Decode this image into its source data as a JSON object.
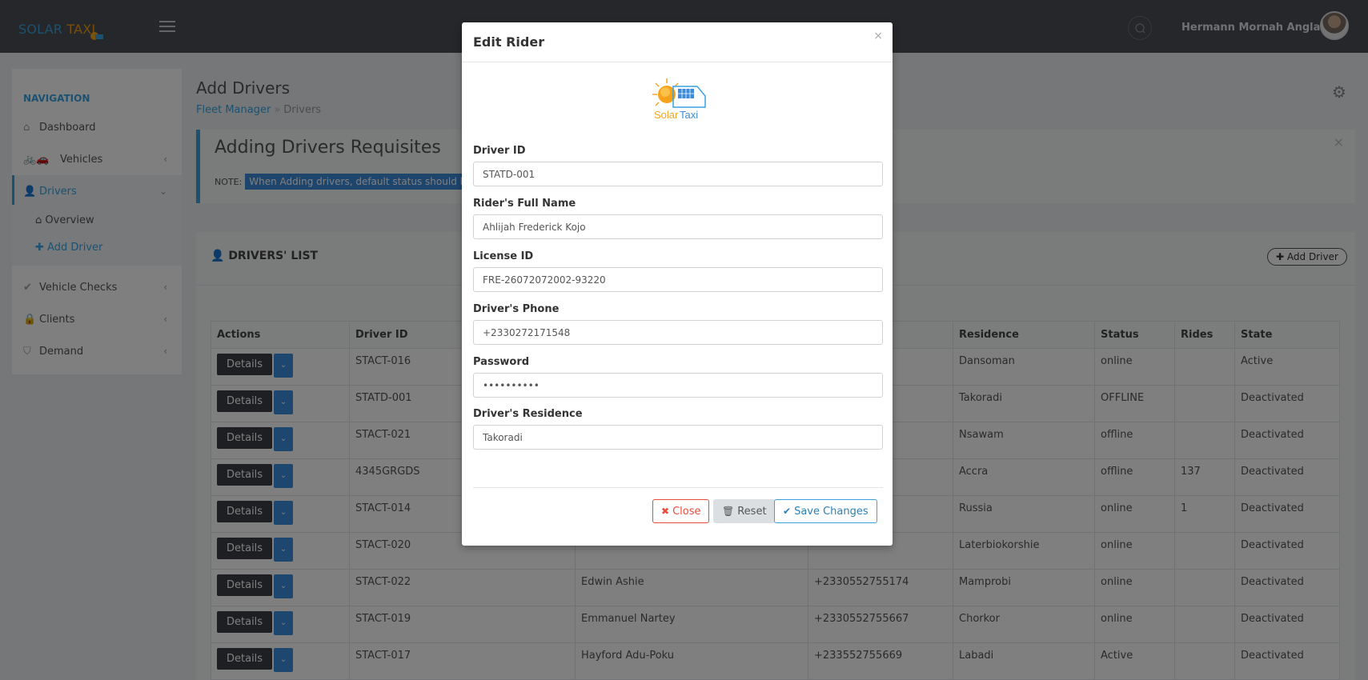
{
  "topbar": {
    "logo_part1": "SOLAR ",
    "logo_part2": "TAXI",
    "user_name": "Hermann Mornah Anglania"
  },
  "sidebar": {
    "nav_title": "NAVIGATION",
    "items": [
      {
        "label": "Dashboard",
        "icon": "home-icon"
      },
      {
        "label": "Vehicles",
        "icon": "car-icon"
      },
      {
        "label": "Drivers",
        "icon": "user-icon"
      },
      {
        "label": "Vehicle Checks",
        "icon": "check-icon"
      },
      {
        "label": "Clients",
        "icon": "user-lock-icon"
      },
      {
        "label": "Demand",
        "icon": "shield-icon"
      }
    ],
    "sub_items": [
      {
        "label": "Overview",
        "icon": "home-icon"
      },
      {
        "label": "Add Driver",
        "icon": "plus-icon"
      }
    ]
  },
  "page": {
    "title": "Add Drivers",
    "breadcrumb_root": "Fleet Manager",
    "breadcrumb_current": "Drivers"
  },
  "note": {
    "title": "Adding Drivers Requisites",
    "prefix": "NOTE:",
    "text": "When Adding drivers, default status should be O"
  },
  "panel": {
    "title": "DRIVERS' LIST",
    "add_button": "Add Driver"
  },
  "table": {
    "headers": [
      "Actions",
      "Driver ID",
      "",
      "",
      "Residence",
      "Status",
      "Rides",
      "State"
    ],
    "details_label": "Details",
    "rows": [
      {
        "id": "STACT-016",
        "name": "",
        "phone": "",
        "residence": "Dansoman",
        "status": "online",
        "rides": "",
        "state": "Active"
      },
      {
        "id": "STATD-001",
        "name": "",
        "phone": "",
        "residence": "Takoradi",
        "status": "OFFLINE",
        "rides": "",
        "state": "Deactivated"
      },
      {
        "id": "STACT-021",
        "name": "",
        "phone": "",
        "residence": "Nsawam",
        "status": "offline",
        "rides": "",
        "state": "Deactivated"
      },
      {
        "id": "4345GRGDS",
        "name": "",
        "phone": "",
        "residence": "Accra",
        "status": "offline",
        "rides": "137",
        "state": "Deactivated"
      },
      {
        "id": "STACT-014",
        "name": "",
        "phone": "",
        "residence": "Russia",
        "status": "online",
        "rides": "1",
        "state": "Deactivated"
      },
      {
        "id": "STACT-020",
        "name": "",
        "phone": "",
        "residence": "Laterbiokorshie",
        "status": "online",
        "rides": "",
        "state": "Deactivated"
      },
      {
        "id": "STACT-022",
        "name": "Edwin Ashie",
        "phone": "+2330552755174",
        "residence": "Mamprobi",
        "status": "online",
        "rides": "",
        "state": "Deactivated"
      },
      {
        "id": "STACT-019",
        "name": "Emmanuel Nartey",
        "phone": "+2330552755667",
        "residence": "Chorkor",
        "status": "online",
        "rides": "",
        "state": "Deactivated"
      },
      {
        "id": "STACT-017",
        "name": "Hayford Adu-Poku",
        "phone": "+233552755669",
        "residence": "Labadi",
        "status": "Active",
        "rides": "",
        "state": "Deactivated"
      }
    ]
  },
  "modal": {
    "title": "Edit Rider",
    "brand_text_1": "Solar",
    "brand_text_2": "Taxi",
    "fields": {
      "driver_id": {
        "label": "Driver ID",
        "value": "STATD-001"
      },
      "full_name": {
        "label": "Rider's Full Name",
        "value": "Ahlijah Frederick Kojo"
      },
      "license_id": {
        "label": "License ID",
        "value": "FRE-26072072002-93220"
      },
      "phone": {
        "label": "Driver's Phone",
        "value": "+2330272171548"
      },
      "password": {
        "label": "Password",
        "value": "••••••••••"
      },
      "residence": {
        "label": "Driver's Residence",
        "value": "Takoradi"
      }
    },
    "buttons": {
      "close": "Close",
      "reset": "Reset",
      "save": "Save Changes"
    }
  },
  "colors": {
    "accent": "#39a3e0",
    "danger": "#e74c3c",
    "topbar": "#4a4f54",
    "button_dark": "#3b3f44"
  }
}
